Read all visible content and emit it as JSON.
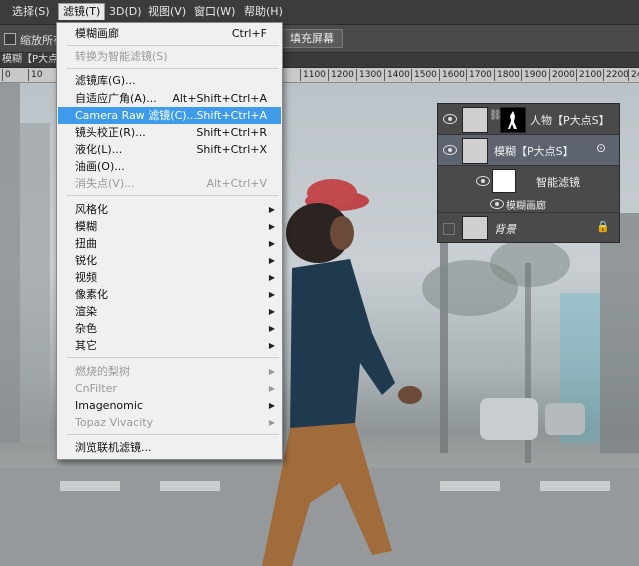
{
  "menubar": {
    "items": [
      {
        "label": "选择(S)"
      },
      {
        "label": "滤镜(T)"
      },
      {
        "label": "3D(D)"
      },
      {
        "label": "视图(V)"
      },
      {
        "label": "窗口(W)"
      },
      {
        "label": "帮助(H)"
      }
    ],
    "active_index": 1
  },
  "options_bar": {
    "resize_all_label": "缩放所有",
    "fill_screen_label": "填充屏幕"
  },
  "document_tab": {
    "label": "模糊【P大点S"
  },
  "ruler": {
    "ticks": [
      "0",
      "10",
      "1100",
      "1200",
      "1300",
      "1400",
      "1500",
      "1600",
      "1700",
      "1800",
      "1900",
      "2000",
      "2100",
      "2200",
      "2300",
      "24"
    ]
  },
  "filter_menu": {
    "items": [
      {
        "label": "模糊画廊",
        "shortcut": "Ctrl+F"
      },
      {
        "label": "转换为智能滤镜(S)",
        "disabled": true
      },
      {
        "label": "滤镜库(G)..."
      },
      {
        "label": "自适应广角(A)...",
        "shortcut": "Alt+Shift+Ctrl+A"
      },
      {
        "label": "Camera Raw 滤镜(C)...",
        "shortcut": "Shift+Ctrl+A",
        "highlighted": true
      },
      {
        "label": "镜头校正(R)...",
        "shortcut": "Shift+Ctrl+R"
      },
      {
        "label": "液化(L)...",
        "shortcut": "Shift+Ctrl+X"
      },
      {
        "label": "油画(O)..."
      },
      {
        "label": "消失点(V)...",
        "shortcut": "Alt+Ctrl+V",
        "disabled": true
      },
      {
        "label": "风格化",
        "submenu": true
      },
      {
        "label": "模糊",
        "submenu": true
      },
      {
        "label": "扭曲",
        "submenu": true
      },
      {
        "label": "锐化",
        "submenu": true
      },
      {
        "label": "视频",
        "submenu": true
      },
      {
        "label": "像素化",
        "submenu": true
      },
      {
        "label": "渲染",
        "submenu": true
      },
      {
        "label": "杂色",
        "submenu": true
      },
      {
        "label": "其它",
        "submenu": true
      },
      {
        "label": "燃烧的梨树",
        "submenu": true,
        "disabled": true
      },
      {
        "label": "CnFilter",
        "submenu": true,
        "disabled": true
      },
      {
        "label": "Imagenomic",
        "submenu": true
      },
      {
        "label": "Topaz Vivacity",
        "submenu": true,
        "disabled": true
      },
      {
        "label": "浏览联机滤镜..."
      }
    ]
  },
  "layers_panel": {
    "layers": [
      {
        "name": "人物【P大点S】",
        "selected": false
      },
      {
        "name": "模糊【P大点S】",
        "selected": true
      },
      {
        "name": "智能滤镜",
        "sub": true
      },
      {
        "name": "模糊画廊",
        "sub": true,
        "filter": true
      },
      {
        "name": "背景",
        "locked": true
      }
    ]
  },
  "icons": {
    "eye": "eye-icon",
    "lock": "lock-icon",
    "link": "chain-link-icon",
    "submenu": "submenu-arrow-icon",
    "smart_filter_options": "filter-options-icon"
  },
  "colors": {
    "highlight": "#3d9be9",
    "menubar": "#3c3c3c",
    "menu_bg": "#f0f0f0",
    "selected_layer": "#5d6470"
  }
}
